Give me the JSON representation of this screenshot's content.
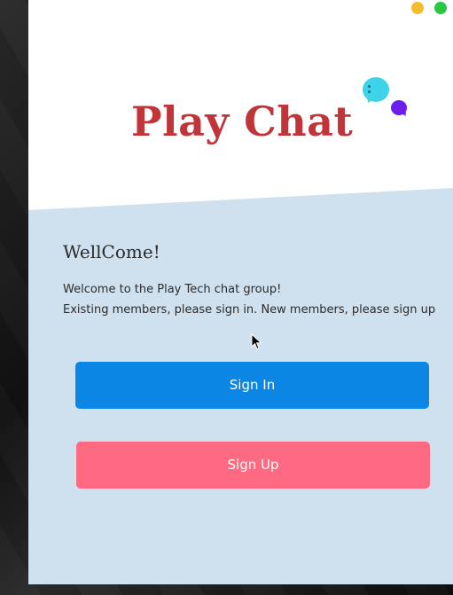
{
  "app": {
    "title": "Play Chat"
  },
  "window_controls": {
    "minimize_color": "#f5bd2e",
    "maximize_color": "#28c940"
  },
  "welcome": {
    "heading": "WellCome!",
    "line1": "Welcome to the Play Tech chat group!",
    "line2": "Existing members, please sign in. New members, please sign up"
  },
  "buttons": {
    "sign_in": "Sign In",
    "sign_up": "Sign Up"
  },
  "colors": {
    "title": "#c0353a",
    "sign_in_bg": "#0b86e4",
    "sign_up_bg": "#fd6a81",
    "panel_bg": "#cfe0ee",
    "bubble_cyan": "#3dd4ea",
    "bubble_purple": "#6a1ff0"
  },
  "icons": {
    "logo": "chat-bubbles-icon",
    "pointer": "mouse-cursor-icon"
  }
}
